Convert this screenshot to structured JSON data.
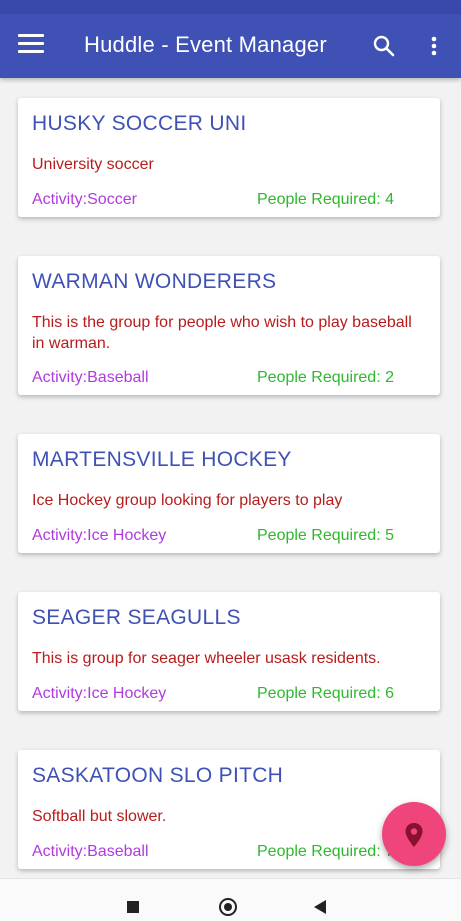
{
  "app_bar": {
    "title": "Huddle - Event Manager",
    "menu_icon": "hamburger-menu-icon",
    "search_icon": "search-icon",
    "more_icon": "more-vert-icon"
  },
  "events": [
    {
      "title": "HUSKY SOCCER UNI",
      "description": "University soccer",
      "activity": "Activity:Soccer",
      "people": "People Required: 4"
    },
    {
      "title": "WARMAN WONDERERS",
      "description": "This is the group for people who wish to play baseball in warman.",
      "activity": "Activity:Baseball",
      "people": "People Required: 2"
    },
    {
      "title": "MARTENSVILLE HOCKEY",
      "description": "Ice Hockey group looking for players to play",
      "activity": "Activity:Ice Hockey",
      "people": "People Required: 5"
    },
    {
      "title": "SEAGER SEAGULLS",
      "description": "This is group for seager wheeler usask residents.",
      "activity": "Activity:Ice Hockey",
      "people": "People Required: 6"
    },
    {
      "title": "SASKATOON SLO PITCH",
      "description": "Softball but slower.",
      "activity": "Activity:Baseball",
      "people": "People Required: 7"
    }
  ],
  "fab": {
    "icon": "location-pin-icon"
  },
  "colors": {
    "primary": "#3f51b5",
    "title": "#3f51b5",
    "description": "#b71c1c",
    "activity": "#b03ae0",
    "people": "#2eb82e",
    "fab": "#f0457a"
  }
}
